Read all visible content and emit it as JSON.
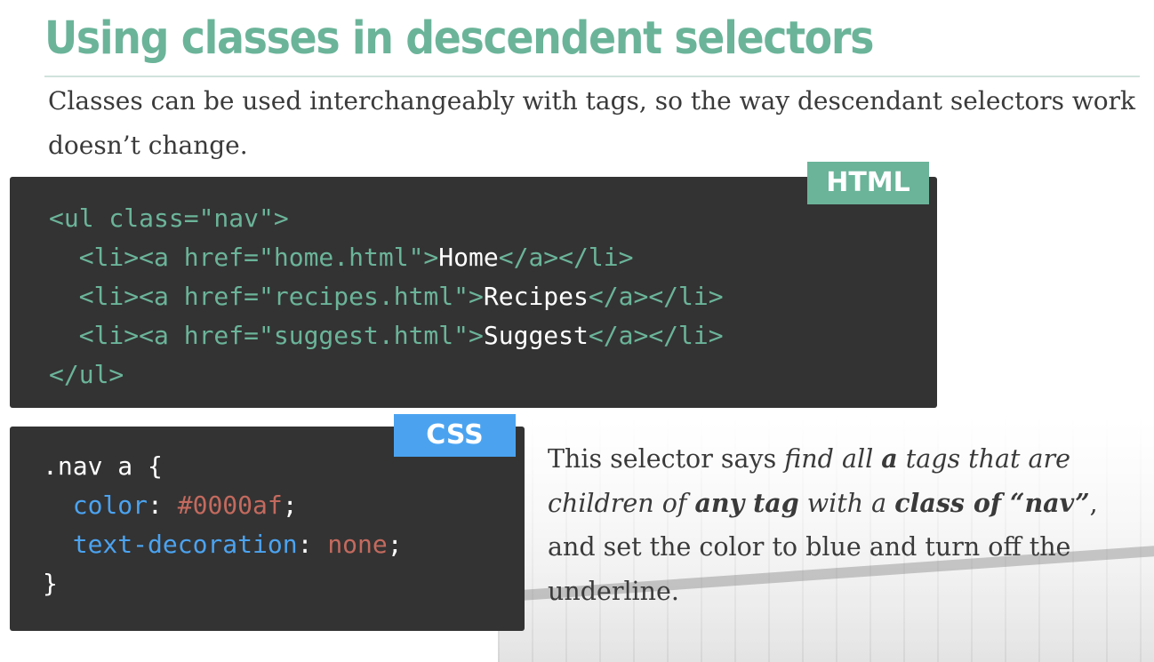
{
  "slide": {
    "title": "Using classes in descendent selectors",
    "intro": "Classes can be used interchangeably with tags, so the way descendant selectors work doesn’t change."
  },
  "html_panel": {
    "badge": "HTML",
    "lines": [
      {
        "open": "<ul class=\"nav\">"
      },
      {
        "prefix": "  <li><a href=\"home.html\">",
        "text": "Home",
        "suffix": "</a></li>"
      },
      {
        "prefix": "  <li><a href=\"recipes.html\">",
        "text": "Recipes",
        "suffix": "</a></li>"
      },
      {
        "prefix": "  <li><a href=\"suggest.html\">",
        "text": "Suggest",
        "suffix": "</a></li>"
      },
      {
        "close": "</ul>"
      }
    ]
  },
  "css_panel": {
    "badge": "CSS",
    "selector_line": ".nav a {",
    "decl1_prop": "color",
    "decl1_value": "#0000af",
    "decl2_prop": "text-decoration",
    "decl2_value": "none",
    "close": "}"
  },
  "description": {
    "p1": "This selector says ",
    "p2": "find all ",
    "p3": "a",
    "p4": " tags that are children of ",
    "p5": "any tag",
    "p6": " with a ",
    "p7": "class of “nav”",
    "p8": ", and set the color to blue and turn off the underline."
  },
  "colors": {
    "accent_green": "#6bb49a",
    "accent_blue": "#4ba3f0",
    "code_bg": "#333333",
    "value_red": "#c46a5e"
  }
}
